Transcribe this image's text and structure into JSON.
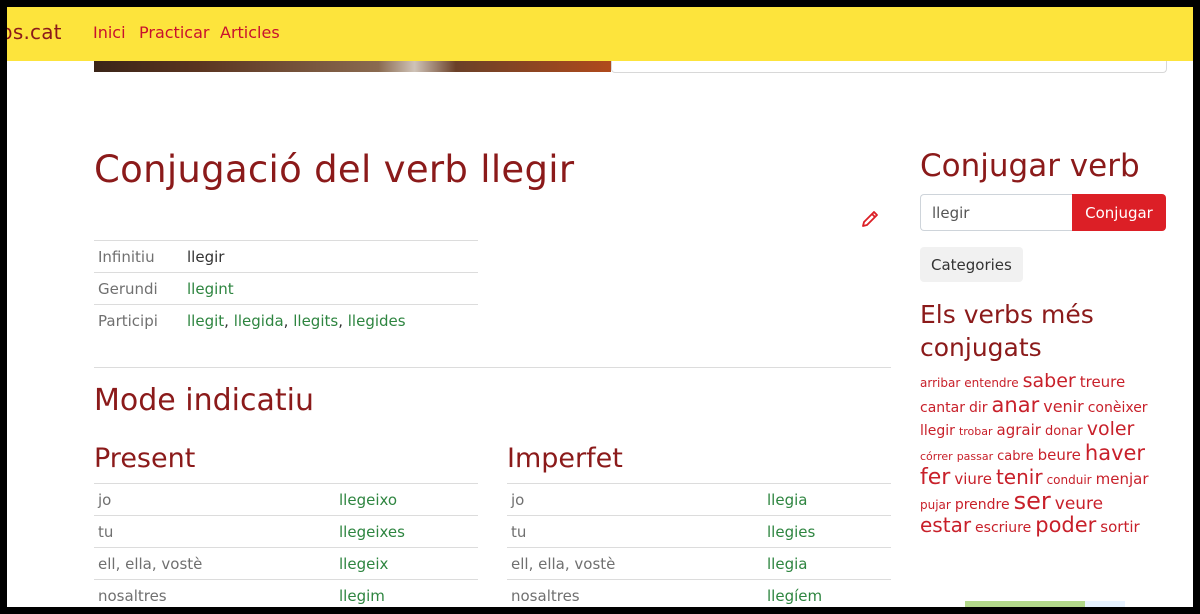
{
  "nav": {
    "brand": "erbs.cat",
    "links": [
      "Inici",
      "Practicar",
      "Articles"
    ]
  },
  "main": {
    "title": "Conjugació del verb llegir",
    "forms": {
      "infinitiu_label": "Infinitiu",
      "infinitiu_value": "llegir",
      "gerundi_label": "Gerundi",
      "gerundi_value": "llegint",
      "participi_label": "Participi",
      "participi_values": [
        "llegit",
        "llegida",
        "llegits",
        "llegides"
      ],
      "separator": ","
    },
    "mode_title": "Mode indicatiu",
    "present": {
      "title": "Present",
      "rows": [
        {
          "pronoun": "jo",
          "form": "llegeixo"
        },
        {
          "pronoun": "tu",
          "form": "llegeixes"
        },
        {
          "pronoun": "ell, ella, vostè",
          "form": "llegeix"
        },
        {
          "pronoun": "nosaltres",
          "form": "llegim"
        }
      ]
    },
    "imperfet": {
      "title": "Imperfet",
      "rows": [
        {
          "pronoun": "jo",
          "form": "llegia"
        },
        {
          "pronoun": "tu",
          "form": "llegies"
        },
        {
          "pronoun": "ell, ella, vostè",
          "form": "llegia"
        },
        {
          "pronoun": "nosaltres",
          "form": "llegíem"
        }
      ]
    }
  },
  "sidebar": {
    "title": "Conjugar verb",
    "search_value": "llegir",
    "button_label": "Conjugar",
    "categories_label": "Categories",
    "popular_title": "Els verbs més conjugats",
    "cloud": [
      [
        [
          "arribar",
          12
        ],
        [
          "entendre",
          12
        ],
        [
          "saber",
          19
        ],
        [
          "treure",
          15
        ]
      ],
      [
        [
          "cantar",
          14
        ],
        [
          "dir",
          14
        ],
        [
          "anar",
          21
        ],
        [
          "venir",
          16
        ],
        [
          "conèixer",
          14
        ]
      ],
      [
        [
          "llegir",
          14
        ],
        [
          "trobar",
          11
        ],
        [
          "agrair",
          15
        ],
        [
          "donar",
          13
        ],
        [
          "voler",
          19
        ]
      ],
      [
        [
          "córrer",
          11
        ],
        [
          "passar",
          11
        ],
        [
          "cabre",
          13
        ],
        [
          "beure",
          15
        ],
        [
          "haver",
          21
        ]
      ],
      [
        [
          "fer",
          22
        ],
        [
          "viure",
          15
        ],
        [
          "tenir",
          20
        ],
        [
          "conduir",
          12
        ],
        [
          "menjar",
          15
        ]
      ],
      [
        [
          "pujar",
          12
        ],
        [
          "prendre",
          14
        ],
        [
          "ser",
          24
        ],
        [
          "veure",
          17
        ]
      ],
      [
        [
          "estar",
          20
        ],
        [
          "escriure",
          14
        ],
        [
          "poder",
          21
        ],
        [
          "sortir",
          15
        ]
      ]
    ]
  },
  "colors": {
    "navbar": "#fde43c",
    "heading": "#8b1a1a",
    "link_green": "#2e8540",
    "button_red": "#dc1f26",
    "cloud_red": "#c8202a"
  }
}
